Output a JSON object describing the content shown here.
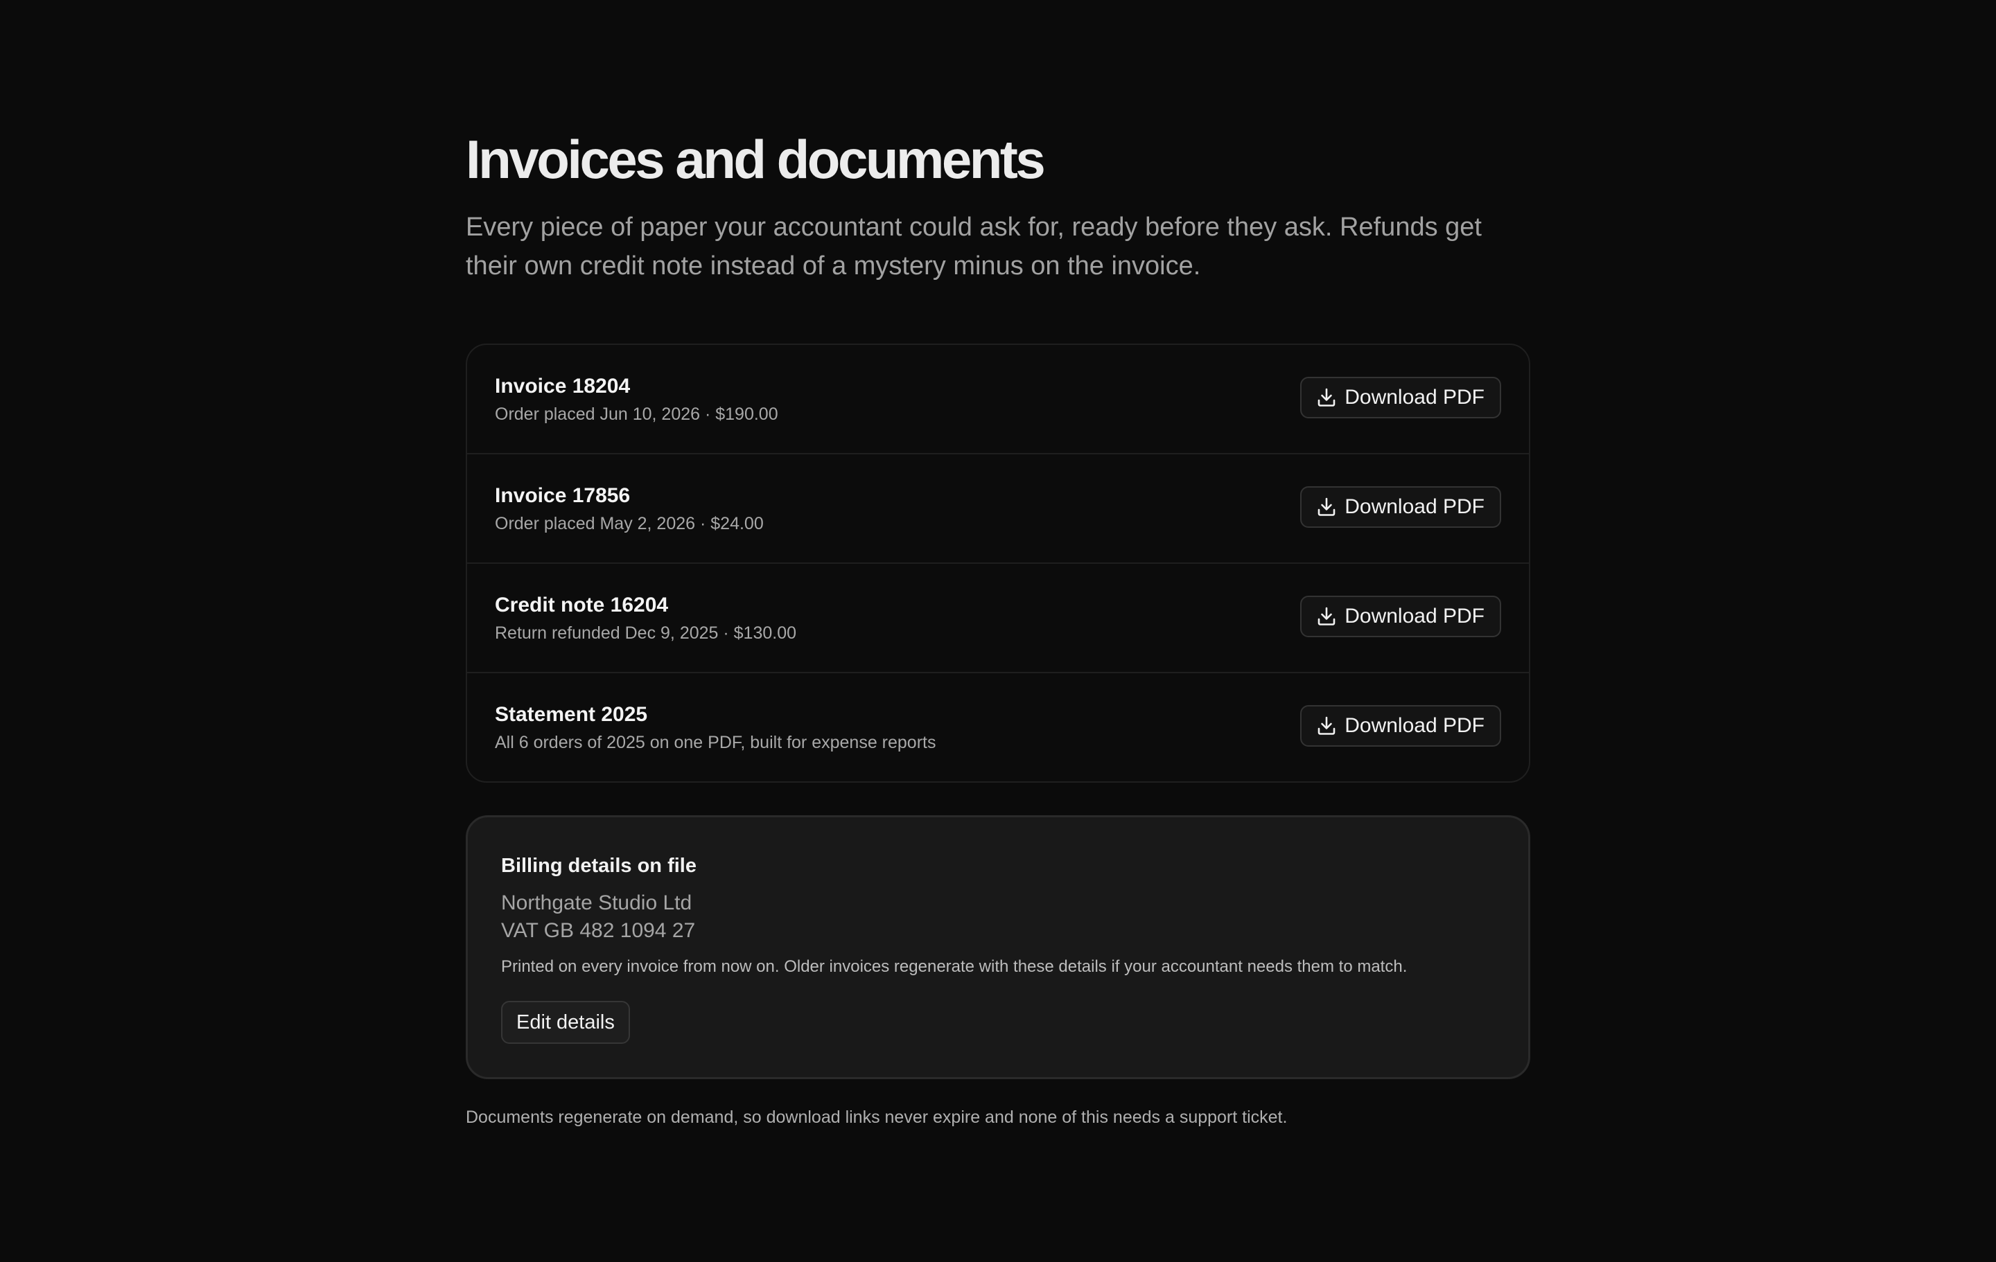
{
  "header": {
    "title": "Invoices and documents",
    "subtitle": "Every piece of paper your accountant could ask for, ready before they ask. Refunds get their own credit note instead of a mystery minus on the invoice."
  },
  "documents": [
    {
      "title": "Invoice 18204",
      "meta": "Order placed Jun 10, 2026 · $190.00",
      "action": "Download PDF",
      "icon": "download-icon"
    },
    {
      "title": "Invoice 17856",
      "meta": "Order placed May 2, 2026 · $24.00",
      "action": "Download PDF",
      "icon": "download-icon"
    },
    {
      "title": "Credit note 16204",
      "meta": "Return refunded Dec 9, 2025 · $130.00",
      "action": "Download PDF",
      "icon": "download-icon"
    },
    {
      "title": "Statement 2025",
      "meta": "All 6 orders of 2025 on one PDF, built for expense reports",
      "action": "Download PDF",
      "icon": "download-icon"
    }
  ],
  "billing": {
    "heading": "Billing details on file",
    "company": "Northgate Studio Ltd",
    "vat": "VAT GB 482 1094 27",
    "note": "Printed on every invoice from now on. Older invoices regenerate with these details if your accountant needs them to match.",
    "edit_label": "Edit details"
  },
  "footer": {
    "note": "Documents regenerate on demand, so download links never expire and none of this needs a support ticket."
  },
  "colors": {
    "background": "#0b0b0b",
    "card": "#191919",
    "border": "#1f1f1f",
    "text_primary": "#ededed",
    "text_secondary": "#a2a2a2"
  }
}
